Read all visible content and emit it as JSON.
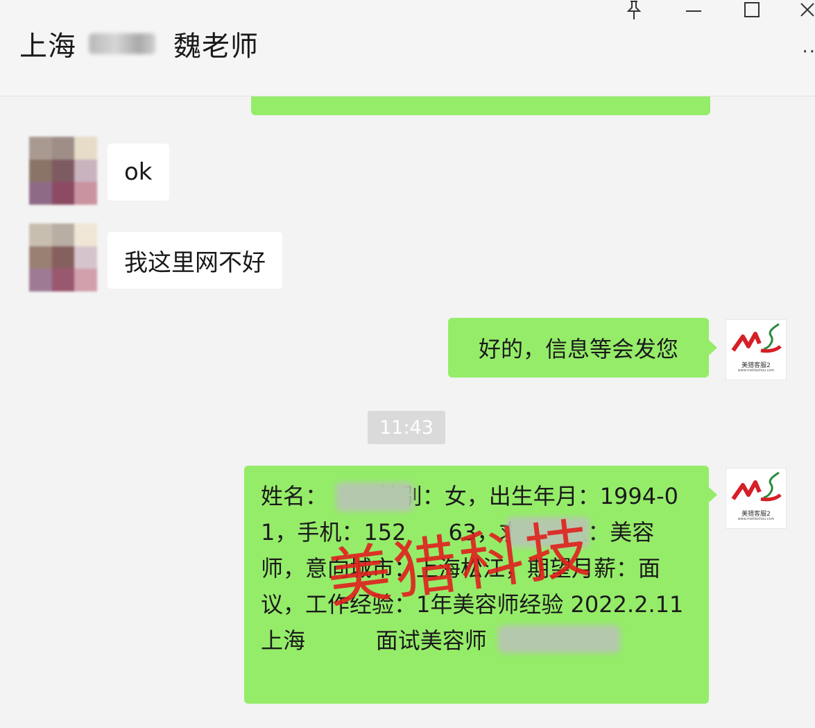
{
  "window": {
    "title_prefix": "上海",
    "title_suffix": "魏老师",
    "pin_icon": "pin-icon",
    "minimize_icon": "minimize-icon",
    "maximize_icon": "maximize-icon",
    "close_icon": "close-icon",
    "more_icon": "more-icon"
  },
  "messages": {
    "incoming": [
      {
        "text": "ok"
      },
      {
        "text": "我这里网不好"
      }
    ],
    "outgoing_reply": {
      "text": "好的，信息等会发您"
    },
    "timestamp": "11:43",
    "profile": {
      "text": "姓名：    ，性别：女，出生年月：1994-01，手机：152      63，求职岗位：美容师，意向城市：上海松江，期望月薪：面议，工作经验：1年美容师经验 2022.2.11上海          面试美容师"
    }
  },
  "logo": {
    "caption": "美猎客服2",
    "subcaption": "www.meilieshou.com"
  },
  "watermark": "美猎科技",
  "colors": {
    "outgoing_bubble": "#95ec69",
    "incoming_bubble": "#ffffff",
    "background": "#f3f3f3",
    "watermark": "#e0201e"
  }
}
